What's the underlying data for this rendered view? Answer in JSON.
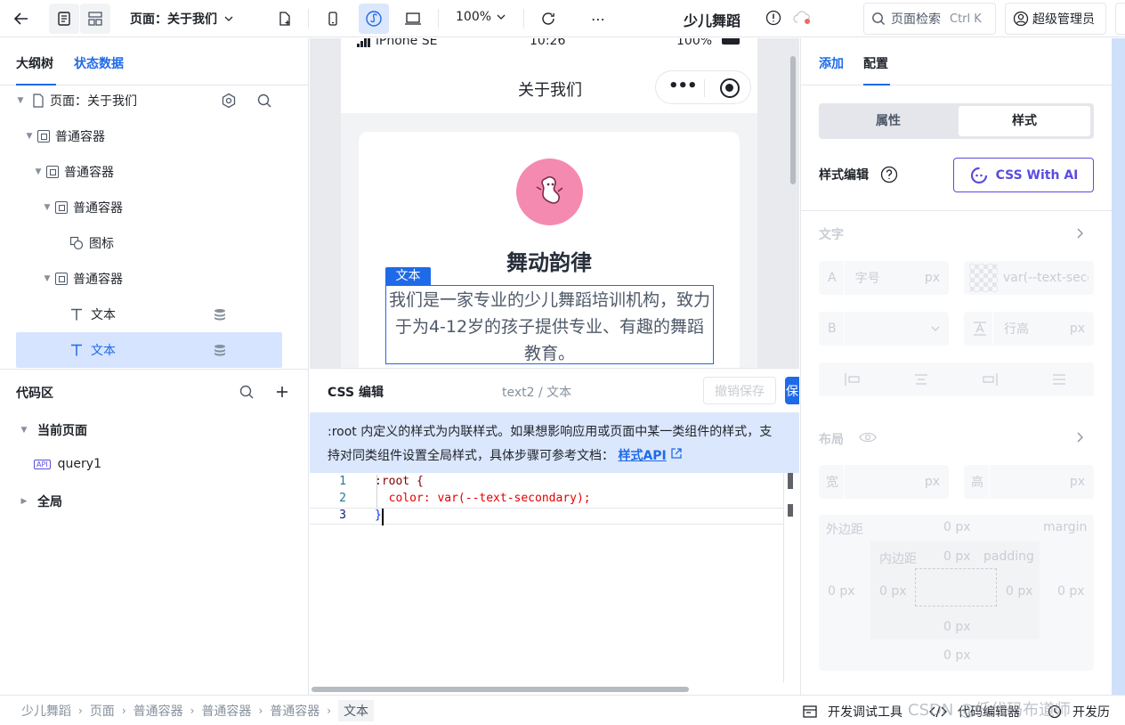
{
  "topbar": {
    "page_selector": "页面：关于我们",
    "zoom": "100%",
    "app_name": "少儿舞蹈",
    "search_placeholder": "页面检索",
    "search_shortcut": "Ctrl K",
    "user": "超级管理员"
  },
  "left": {
    "tabs": [
      "大纲树",
      "状态数据"
    ],
    "tree": [
      {
        "label": "页面：关于我们"
      },
      {
        "label": "普通容器"
      },
      {
        "label": "普通容器"
      },
      {
        "label": "普通容器"
      },
      {
        "label": "图标"
      },
      {
        "label": "普通容器"
      },
      {
        "label": "文本"
      },
      {
        "label": "文本"
      }
    ],
    "code_area_title": "代码区",
    "code_tree": [
      {
        "label": "当前页面"
      },
      {
        "label": "query1",
        "badge": "API"
      },
      {
        "label": "全局"
      }
    ]
  },
  "phone": {
    "device": "iPhone SE",
    "time": "10:26",
    "battery": "100%",
    "page_title": "关于我们",
    "heading": "舞动韵律",
    "selection_tag": "文本",
    "body_text": "我们是一家专业的少儿舞蹈培训机构，致力于为4-12岁的孩子提供专业、有趣的舞蹈教育。"
  },
  "css_editor": {
    "title": "CSS 编辑",
    "path": "text2 / 文本",
    "undo_label": "撤销保存",
    "save_label": "保",
    "notice": ":root 内定义的样式为内联样式。如果想影响应用或页面中某一类组件的样式，支持对同类组件设置全局样式，具体步骤可参考文档：",
    "notice_link": "样式API",
    "lines": [
      {
        "num": "1",
        "code": ":root {"
      },
      {
        "num": "2",
        "code": "  color: var(--text-secondary);"
      },
      {
        "num": "3",
        "code": "}"
      }
    ]
  },
  "right": {
    "tabs": [
      "添加",
      "配置"
    ],
    "segment": [
      "属性",
      "样式"
    ],
    "style_edit_label": "样式编辑",
    "css_ai_label": "CSS With AI",
    "text_section": "文字",
    "font_size_prefix": "A",
    "font_size_placeholder": "字号",
    "px": "px",
    "color_value": "var(--text-secc",
    "bold_prefix": "B",
    "line_height_placeholder": "行高",
    "layout_section": "布局",
    "width_label": "宽",
    "height_label": "高",
    "margin_label_cn": "外边距",
    "margin_label_en": "margin",
    "padding_label_cn": "内边距",
    "padding_label_en": "padding",
    "zero_px": "0 px"
  },
  "bottombar": {
    "crumbs": [
      "少儿舞蹈",
      "页面",
      "普通容器",
      "普通容器",
      "普通容器",
      "文本"
    ],
    "devtools": "开发调试工具",
    "code_editor": "代码编辑器",
    "history": "开发历",
    "watermark": "CSDN @低代码布道师"
  },
  "colors": {
    "accent": "#1f6ae8",
    "selection_bg": "#d6e4ff",
    "notice_bg": "#dbe7fd",
    "avatar_pink": "#f58ab0",
    "ai_purple": "#5b4ce0"
  }
}
